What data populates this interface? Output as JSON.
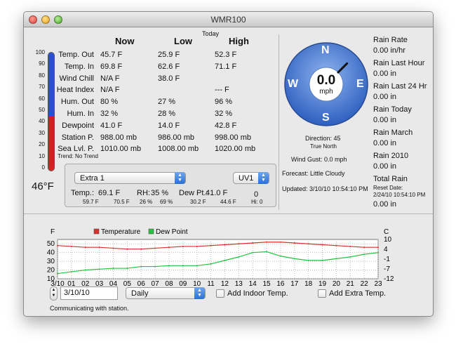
{
  "window": {
    "title": "WMR100"
  },
  "current": {
    "today_label": "Today",
    "headers": {
      "now": "Now",
      "low": "Low",
      "high": "High"
    },
    "rows": [
      {
        "label": "Temp. Out",
        "now": "45.7 F",
        "low": "25.9 F",
        "high": "52.3 F"
      },
      {
        "label": "Temp. In",
        "now": "69.8 F",
        "low": "62.6 F",
        "high": "71.1 F"
      },
      {
        "label": "Wind Chill",
        "now": "N/A F",
        "low": "38.0 F",
        "high": ""
      },
      {
        "label": "Heat Index",
        "now": "N/A F",
        "low": "",
        "high": "--- F"
      },
      {
        "label": "Hum. Out",
        "now": "80 %",
        "low": "27 %",
        "high": "96 %"
      },
      {
        "label": "Hum. In",
        "now": "32 %",
        "low": "28 %",
        "high": "32 %"
      },
      {
        "label": "Dewpoint",
        "now": "41.0 F",
        "low": "14.0 F",
        "high": "42.8 F"
      },
      {
        "label": "Station P.",
        "now": "988.00 mb",
        "low": "986.00 mb",
        "high": "998.00 mb"
      },
      {
        "label": "Sea Lvl. P.",
        "now": "1010.00 mb",
        "low": "1008.00 mb",
        "high": "1020.00 mb"
      }
    ],
    "trend": "Trend: No Trend"
  },
  "thermometer": {
    "reading": "46°F",
    "scale_labels": [
      "100",
      "90",
      "80",
      "70",
      "60",
      "50",
      "40",
      "30",
      "20",
      "10",
      "0"
    ],
    "scale_min": 0,
    "scale_max": 100,
    "value": 46,
    "colors": {
      "cold": "#2a4fd0",
      "warm": "#d42020"
    }
  },
  "extra": {
    "sensor_select": "Extra 1",
    "uv_select": "UV1",
    "temp_label": "Temp.:",
    "temp_value": "69.1 F",
    "temp_low": "59.7 F",
    "temp_high": "70.5 F",
    "rh_label": "RH:",
    "rh_value": "35 %",
    "rh_low": "26 %",
    "rh_high": "69 %",
    "dew_label": "Dew Pt.:",
    "dew_value": "41.0 F",
    "dew_low": "30.2 F",
    "dew_high": "44.6 F",
    "uv_value": "0",
    "uv_hi": "Hi: 0"
  },
  "wind": {
    "speed": "0.0",
    "unit": "mph",
    "compass": {
      "n": "N",
      "e": "E",
      "s": "S",
      "w": "W"
    },
    "direction_degrees": 45,
    "direction_label": "Direction: 45",
    "direction_ref": "True North",
    "gust": "Wind Gust:  0.0 mph",
    "forecast": "Forecast: Little Cloudy",
    "updated": "Updated: 3/10/10 10:54:10 PM"
  },
  "rain": {
    "items": [
      {
        "label": "Rain Rate",
        "value": "0.00 in/hr"
      },
      {
        "label": "Rain Last Hour",
        "value": "0.00 in"
      },
      {
        "label": "Rain Last 24 Hr",
        "value": "0.00 in"
      },
      {
        "label": "Rain Today",
        "value": "0.00 in"
      },
      {
        "label": "Rain March",
        "value": "0.00 in"
      },
      {
        "label": "Rain 2010",
        "value": "0.00 in"
      }
    ],
    "total_label": "Total Rain",
    "reset_label": "Reset Date:",
    "reset_date": "2/24/10 10:54:10 PM",
    "total_value": "0.00 in"
  },
  "chart_data": {
    "type": "line",
    "left_unit": "F",
    "right_unit": "C",
    "x": [
      "3/10",
      "01",
      "02",
      "03",
      "04",
      "05",
      "06",
      "07",
      "08",
      "09",
      "10",
      "11",
      "12",
      "13",
      "14",
      "15",
      "16",
      "17",
      "18",
      "19",
      "20",
      "21",
      "22",
      "23"
    ],
    "ylim": [
      10,
      55
    ],
    "yticks": [
      10,
      20,
      30,
      40,
      50
    ],
    "y2ticks": [
      "10",
      "4",
      "-1",
      "-7",
      "-12"
    ],
    "series": [
      {
        "name": "Temperature",
        "color": "#d9302a",
        "values": [
          48,
          47,
          46,
          46,
          45,
          44,
          44,
          45,
          46,
          47,
          47,
          48,
          49,
          50,
          51,
          52,
          52,
          51,
          50,
          49,
          48,
          47,
          46,
          46
        ]
      },
      {
        "name": "Dew Point",
        "color": "#28c040",
        "values": [
          16,
          18,
          20,
          21,
          22,
          22,
          24,
          24,
          25,
          25,
          25,
          27,
          31,
          35,
          40,
          41,
          36,
          33,
          31,
          31,
          33,
          35,
          38,
          40
        ]
      }
    ],
    "grid": true,
    "legend": "top"
  },
  "controls": {
    "date_value": "3/10/10",
    "period_select": "Daily",
    "indoor_label": "Add Indoor Temp.",
    "extra_label": "Add Extra Temp."
  },
  "status": "Communicating with station."
}
